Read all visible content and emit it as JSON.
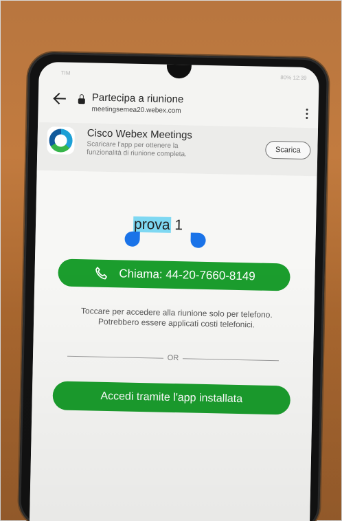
{
  "status_bar": {
    "left": "TIM",
    "right": "80% 12:39"
  },
  "header": {
    "title": "Partecipa a riunione",
    "url": "meetingsemea20.webex.com"
  },
  "banner": {
    "app_name": "Cisco Webex Meetings",
    "description": "Scaricare l'app per ottenere la funzionalità di riunione completa.",
    "download_label": "Scarica"
  },
  "meeting": {
    "name_selected": "prova",
    "name_rest": " 1"
  },
  "call": {
    "label": "Chiama: 44-20-7660-8149",
    "note_line1": "Toccare per accedere alla riunione solo per telefono.",
    "note_line2": "Potrebbero essere applicati costi telefonici."
  },
  "divider": {
    "label": "OR"
  },
  "app_join": {
    "label": "Accedi tramite l'app installata"
  },
  "colors": {
    "wood": "#b8763f",
    "primary_green": "#1b9d2d",
    "selection": "#7ed8f2",
    "selection_handle": "#1a73e8"
  },
  "icons": {
    "back": "back-arrow-icon",
    "lock": "lock-icon",
    "menu": "more-vert-icon",
    "logo": "webex-logo-icon",
    "phone": "phone-icon"
  }
}
